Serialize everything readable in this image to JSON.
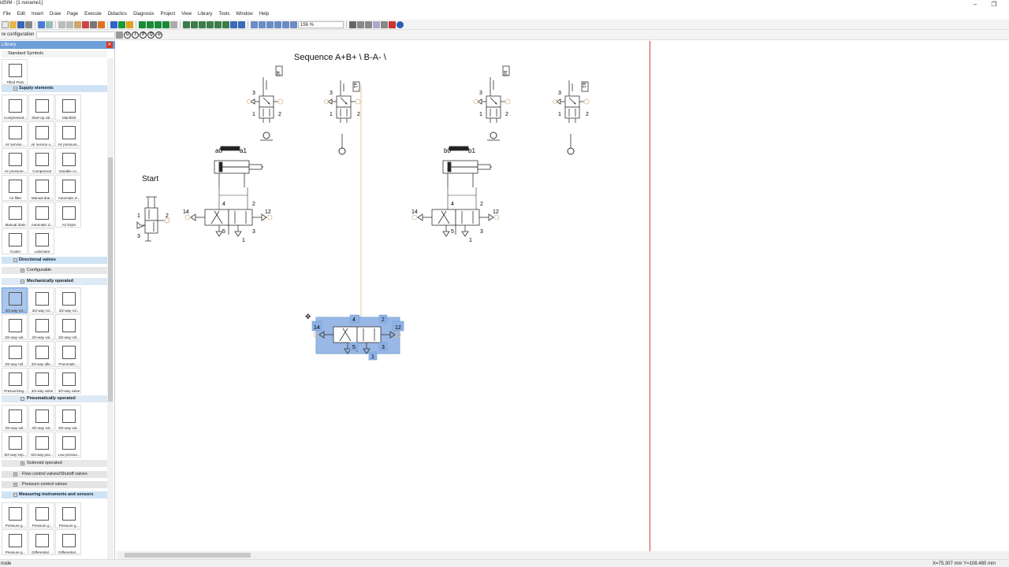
{
  "window": {
    "title": "idSIM - [1  noname1]"
  },
  "menu": [
    "File",
    "Edit",
    "Insert",
    "Draw",
    "Page",
    "Execute",
    "Didactics",
    "Diagnosis",
    "Project",
    "View",
    "Library",
    "Tools",
    "Window",
    "Help"
  ],
  "toolbar": {
    "zoom": "156 %",
    "config_label": "re configuration"
  },
  "library": {
    "title": "Library",
    "standard": "Standard Symbols",
    "first_item": "Filled Pisto",
    "sections": {
      "supply": "Supply elements",
      "directional": "Directional valves",
      "configurable": "Configurable",
      "mechanical": "Mechanically operated",
      "pneumatic": "Pneumatically operated",
      "solenoid": "Solenoid operated",
      "flow": "Flow control valves/Shutoff valves",
      "pressure": "Pressure control valves",
      "measuring": "Measuring instruments and sensors"
    },
    "supply_items": [
      "Compressed...",
      "Start-up val...",
      "Manifold",
      "Air service ...",
      "Air service u...",
      "Air pressure...",
      "Air pressure...",
      "Compressor",
      "Variable co...",
      "Air filter",
      "Manual drai...",
      "Automatic d...",
      "Manual drain",
      "Automatic d...",
      "Air Dryer",
      "Cooler",
      "Lubricator"
    ],
    "mech_items": [
      "3/2-way rol...",
      "3/2-way rol...",
      "3/2-way rol...",
      "3/2-way val...",
      "3/2-way val...",
      "3/2-way roll...",
      "3/2-way roll...",
      "3/2-way idle...",
      "Pneumatic ...",
      "Pressurizing...",
      "3/2-way valve",
      "3/2-way valve"
    ],
    "pneu_items": [
      "3/2-way val...",
      "3/2-way val...",
      "5/2-way val...",
      "5/2-way imp...",
      "5/3-way pne...",
      "Low pressur..."
    ],
    "meas_items": [
      "Pressure g...",
      "Pressure g...",
      "Pressure g...",
      "Pressure g...",
      "Differential ...",
      "Differential ..."
    ]
  },
  "diagram": {
    "title": "Sequence  A+B+ \\ B-A- \\",
    "start": "Start",
    "labels": {
      "a0": "a0",
      "a1": "a1",
      "b0": "b0",
      "b1": "b1"
    },
    "ports": {
      "p1": "1",
      "p2": "2",
      "p3": "3",
      "p4": "4",
      "p5": "5",
      "p12": "12",
      "p14": "14"
    }
  },
  "status": {
    "left": "node",
    "coords": "X=75.307 mm  Y=108.480 mm"
  },
  "colors": {
    "accent": "#6f9fd8",
    "selection": "#8fb1e3",
    "border": "#c44444"
  }
}
